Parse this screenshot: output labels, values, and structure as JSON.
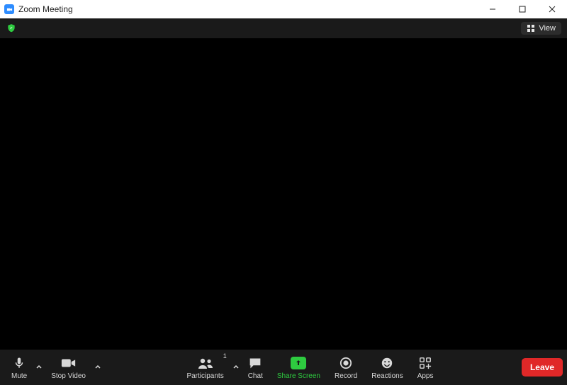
{
  "window": {
    "title": "Zoom Meeting"
  },
  "topbar": {
    "view_label": "View"
  },
  "toolbar": {
    "mute_label": "Mute",
    "stopvideo_label": "Stop Video",
    "participants_label": "Participants",
    "participants_count": "1",
    "chat_label": "Chat",
    "sharescreen_label": "Share Screen",
    "record_label": "Record",
    "reactions_label": "Reactions",
    "apps_label": "Apps",
    "leave_label": "Leave"
  }
}
